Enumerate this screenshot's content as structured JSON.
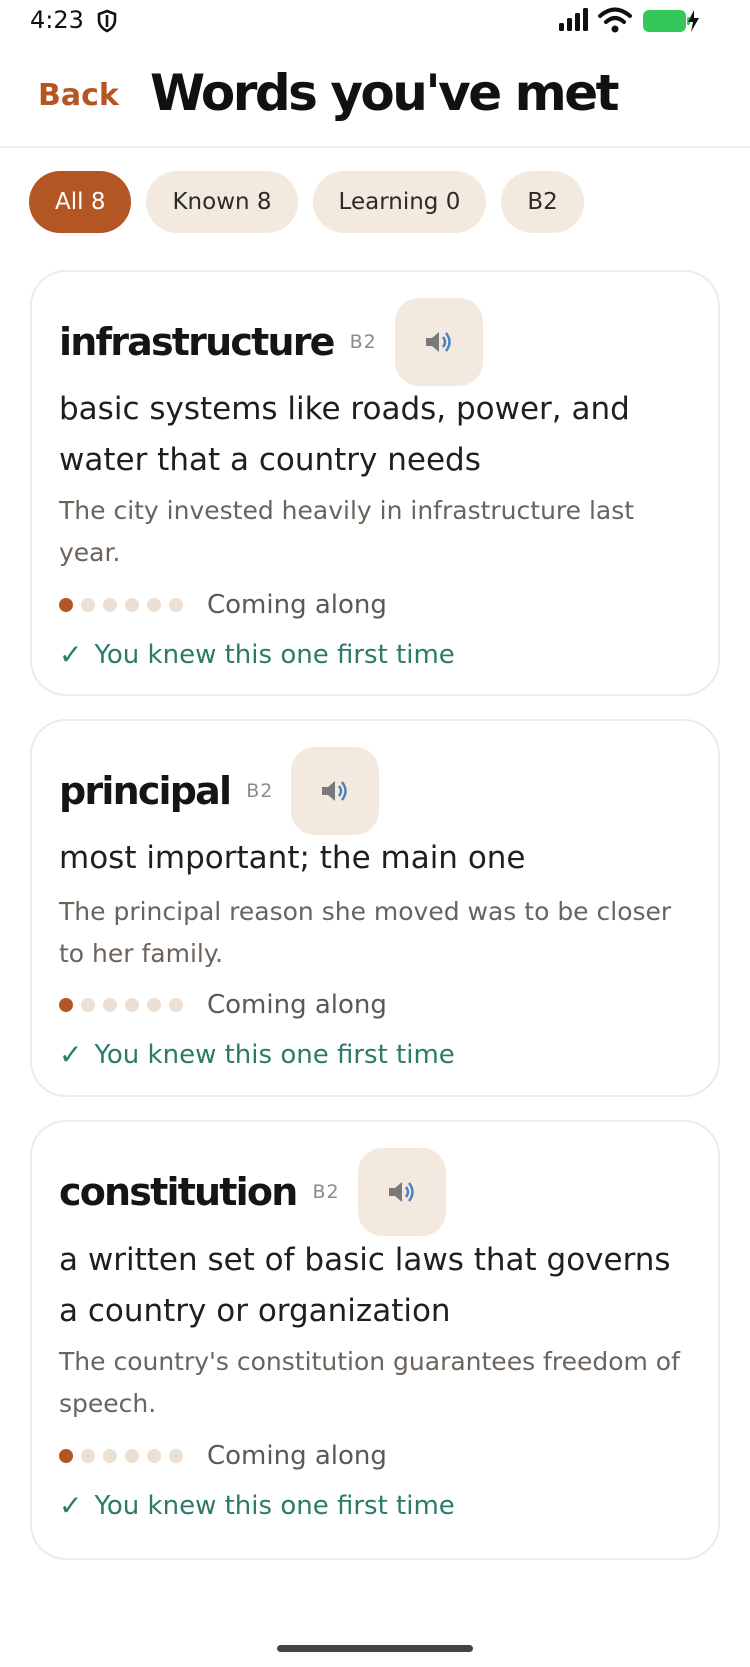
{
  "status": {
    "time": "4:23"
  },
  "header": {
    "back_label": "Back",
    "title": "Words you've met"
  },
  "filters": [
    {
      "label": "All 8",
      "active": true
    },
    {
      "label": "Known 8",
      "active": false
    },
    {
      "label": "Learning 0",
      "active": false
    },
    {
      "label": "B2",
      "active": false
    }
  ],
  "cards": [
    {
      "word": "infrastructure",
      "level": "B2",
      "definition": "basic systems like roads, power, and water that a country needs",
      "example": "The city invested heavily in infrastructure last year.",
      "progress_filled": 1,
      "progress_total": 6,
      "progress_label": "Coming along",
      "knew_label": "You knew this one first time"
    },
    {
      "word": "principal",
      "level": "B2",
      "definition": "most important; the main one",
      "example": "The principal reason she moved was to be closer to her family.",
      "progress_filled": 1,
      "progress_total": 6,
      "progress_label": "Coming along",
      "knew_label": "You knew this one first time"
    },
    {
      "word": "constitution",
      "level": "B2",
      "definition": "a written set of basic laws that governs a country or organization",
      "example": "The country's constitution guarantees freedom of speech.",
      "progress_filled": 1,
      "progress_total": 6,
      "progress_label": "Coming along",
      "knew_label": "You knew this one first time"
    }
  ],
  "colors": {
    "accent": "#b45524",
    "chip_bg": "#f4e9df",
    "success": "#2d7a6a"
  },
  "icons": {
    "speaker": "speaker-icon",
    "check": "check-icon"
  }
}
